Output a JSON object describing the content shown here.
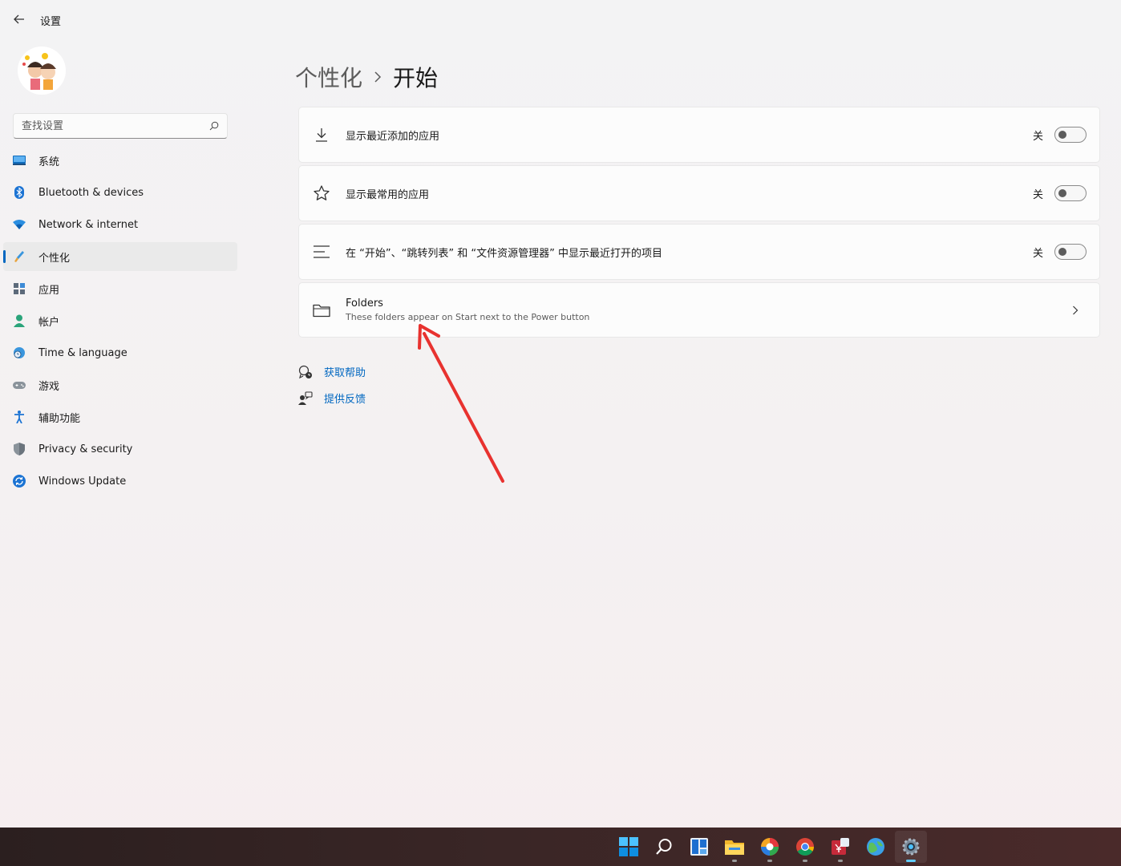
{
  "window": {
    "title": "设置"
  },
  "search": {
    "placeholder": "查找设置"
  },
  "sidebar": {
    "items": [
      {
        "label": "系统",
        "icon": "system-icon"
      },
      {
        "label": "Bluetooth & devices",
        "icon": "bluetooth-icon"
      },
      {
        "label": "Network & internet",
        "icon": "wifi-icon"
      },
      {
        "label": "个性化",
        "icon": "brush-icon",
        "active": true
      },
      {
        "label": "应用",
        "icon": "apps-icon"
      },
      {
        "label": "帐户",
        "icon": "account-icon"
      },
      {
        "label": "Time & language",
        "icon": "globe-clock-icon"
      },
      {
        "label": "游戏",
        "icon": "gamepad-icon"
      },
      {
        "label": "辅助功能",
        "icon": "accessibility-icon"
      },
      {
        "label": "Privacy & security",
        "icon": "shield-icon"
      },
      {
        "label": "Windows Update",
        "icon": "update-icon"
      }
    ]
  },
  "breadcrumb": {
    "parent": "个性化",
    "current": "开始"
  },
  "settings": {
    "recently_added": {
      "label": "显示最近添加的应用",
      "state": "关",
      "icon": "download-icon"
    },
    "most_used": {
      "label": "显示最常用的应用",
      "state": "关",
      "icon": "star-icon"
    },
    "recent_items": {
      "label": "在 “开始”、“跳转列表” 和 “文件资源管理器” 中显示最近打开的项目",
      "state": "关",
      "icon": "list-icon"
    },
    "folders": {
      "title": "Folders",
      "subtitle": "These folders appear on Start next to the Power button",
      "icon": "folder-icon"
    }
  },
  "links": {
    "help": "获取帮助",
    "feedback": "提供反馈"
  },
  "colors": {
    "accent": "#0067c0",
    "annotation_arrow": "#e8322f",
    "taskbar": "#3a2626"
  },
  "taskbar": {
    "icons": [
      "start-icon",
      "search-icon",
      "widgets-icon",
      "file-explorer-icon",
      "colorful-app-icon",
      "chrome-icon",
      "app-icon",
      "maps-icon",
      "settings-icon"
    ]
  }
}
